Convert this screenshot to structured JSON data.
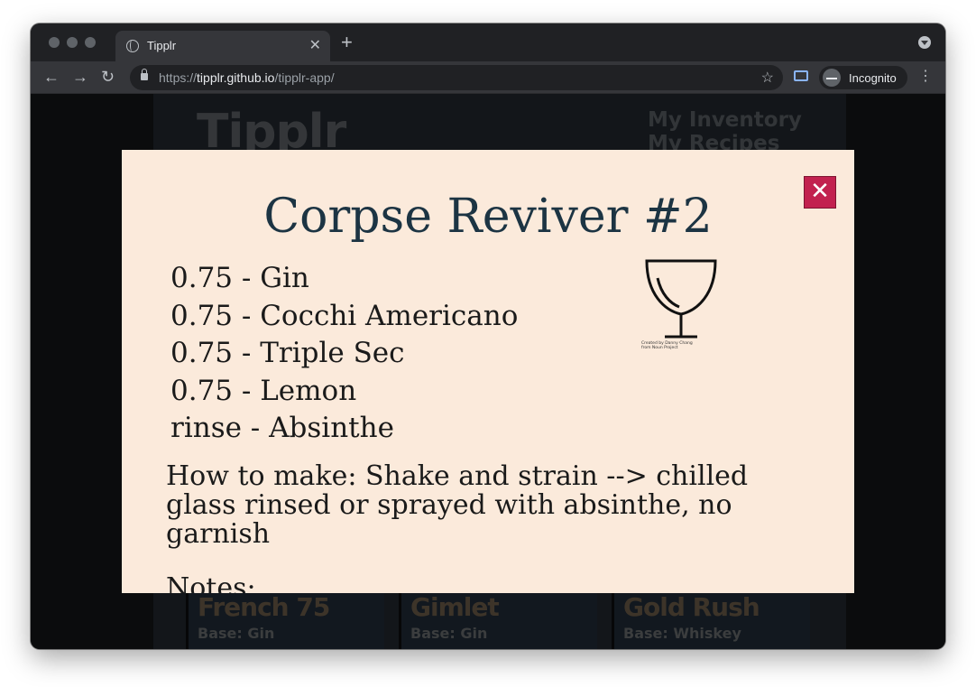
{
  "browser": {
    "tab_title": "Tipplr",
    "tab_close": "✕",
    "new_tab": "+",
    "url_scheme": "https://",
    "url_host": "tipplr.github.io",
    "url_path": "/tipplr-app/",
    "incognito_label": "Incognito",
    "back_glyph": "←",
    "forward_glyph": "→",
    "reload_glyph": "↻",
    "star_glyph": "☆",
    "menu_glyph": "⋮"
  },
  "site": {
    "logo": "Tipplr",
    "nav": [
      "My Inventory",
      "My Recipes"
    ],
    "cards": [
      {
        "name": "French 75",
        "base": "Base: Gin"
      },
      {
        "name": "Gimlet",
        "base": "Base: Gin"
      },
      {
        "name": "Gold Rush",
        "base": "Base: Whiskey"
      }
    ]
  },
  "modal": {
    "close_glyph": "✕",
    "title": "Corpse Reviver #2",
    "ingredients": [
      "0.75 - Gin",
      "0.75 - Cocchi Americano",
      "0.75 - Triple Sec",
      "0.75 - Lemon",
      "rinse - Absinthe"
    ],
    "glass_credit_line1": "Created by Danny Chang",
    "glass_credit_line2": "from Noun Project",
    "instructions": "How to make: Shake and strain --> chilled glass rinsed or sprayed with absinthe, no garnish",
    "notes_label": "Notes:"
  }
}
